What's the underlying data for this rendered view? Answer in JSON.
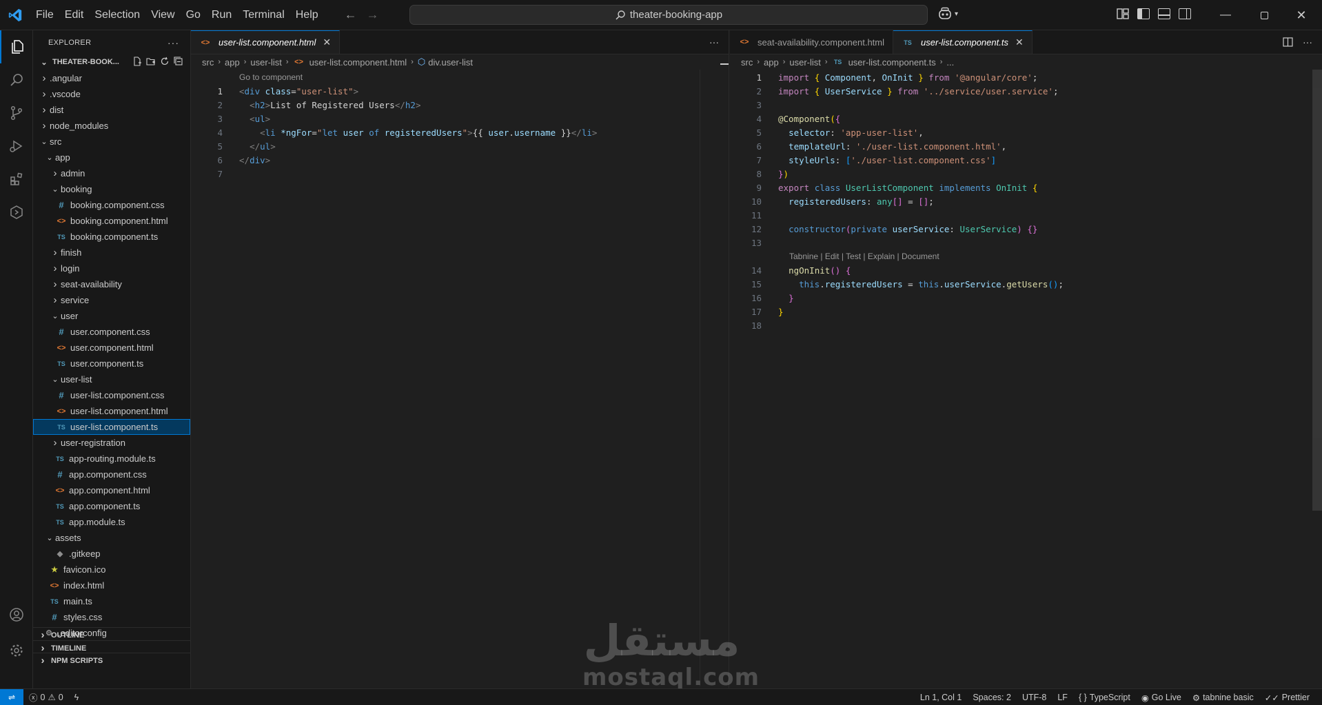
{
  "menu": [
    "File",
    "Edit",
    "Selection",
    "View",
    "Go",
    "Run",
    "Terminal",
    "Help"
  ],
  "command_center": "theater-booking-app",
  "sidebar": {
    "title": "EXPLORER",
    "project": "THEATER-BOOK...",
    "tree": [
      {
        "label": ".angular",
        "indent": 0,
        "type": "folder",
        "open": false
      },
      {
        "label": ".vscode",
        "indent": 0,
        "type": "folder",
        "open": false
      },
      {
        "label": "dist",
        "indent": 0,
        "type": "folder",
        "open": false
      },
      {
        "label": "node_modules",
        "indent": 0,
        "type": "folder",
        "open": false
      },
      {
        "label": "src",
        "indent": 0,
        "type": "folder",
        "open": true
      },
      {
        "label": "app",
        "indent": 1,
        "type": "folder",
        "open": true
      },
      {
        "label": "admin",
        "indent": 2,
        "type": "folder",
        "open": false
      },
      {
        "label": "booking",
        "indent": 2,
        "type": "folder",
        "open": true
      },
      {
        "label": "booking.component.css",
        "indent": 3,
        "type": "css"
      },
      {
        "label": "booking.component.html",
        "indent": 3,
        "type": "html"
      },
      {
        "label": "booking.component.ts",
        "indent": 3,
        "type": "ts"
      },
      {
        "label": "finish",
        "indent": 2,
        "type": "folder",
        "open": false
      },
      {
        "label": "login",
        "indent": 2,
        "type": "folder",
        "open": false
      },
      {
        "label": "seat-availability",
        "indent": 2,
        "type": "folder",
        "open": false
      },
      {
        "label": "service",
        "indent": 2,
        "type": "folder",
        "open": false
      },
      {
        "label": "user",
        "indent": 2,
        "type": "folder",
        "open": true
      },
      {
        "label": "user.component.css",
        "indent": 3,
        "type": "css"
      },
      {
        "label": "user.component.html",
        "indent": 3,
        "type": "html"
      },
      {
        "label": "user.component.ts",
        "indent": 3,
        "type": "ts"
      },
      {
        "label": "user-list",
        "indent": 2,
        "type": "folder",
        "open": true
      },
      {
        "label": "user-list.component.css",
        "indent": 3,
        "type": "css"
      },
      {
        "label": "user-list.component.html",
        "indent": 3,
        "type": "html"
      },
      {
        "label": "user-list.component.ts",
        "indent": 3,
        "type": "ts",
        "selected": true
      },
      {
        "label": "user-registration",
        "indent": 2,
        "type": "folder",
        "open": false
      },
      {
        "label": "app-routing.module.ts",
        "indent": 2,
        "type": "ts",
        "nochev": true
      },
      {
        "label": "app.component.css",
        "indent": 2,
        "type": "css",
        "nochev": true
      },
      {
        "label": "app.component.html",
        "indent": 2,
        "type": "html",
        "nochev": true
      },
      {
        "label": "app.component.ts",
        "indent": 2,
        "type": "ts",
        "nochev": true
      },
      {
        "label": "app.module.ts",
        "indent": 2,
        "type": "ts",
        "nochev": true
      },
      {
        "label": "assets",
        "indent": 1,
        "type": "folder",
        "open": true
      },
      {
        "label": ".gitkeep",
        "indent": 2,
        "type": "git",
        "nochev": true
      },
      {
        "label": "favicon.ico",
        "indent": 1,
        "type": "fav",
        "nochev": true
      },
      {
        "label": "index.html",
        "indent": 1,
        "type": "html",
        "nochev": true
      },
      {
        "label": "main.ts",
        "indent": 1,
        "type": "ts",
        "nochev": true
      },
      {
        "label": "styles.css",
        "indent": 1,
        "type": "css",
        "nochev": true
      },
      {
        "label": ".editorconfig",
        "indent": 0,
        "type": "cfg",
        "nochev": true
      }
    ],
    "sections": [
      "OUTLINE",
      "TIMELINE",
      "NPM SCRIPTS"
    ]
  },
  "left_editor": {
    "tab": "user-list.component.html",
    "breadcrumb": [
      "src",
      "app",
      "user-list",
      "user-list.component.html",
      "div.user-list"
    ],
    "codelens": "Go to component",
    "lines": [
      [
        [
          "tk-punc",
          "<"
        ],
        [
          "tk-tag",
          "div"
        ],
        [
          "tk-text",
          " "
        ],
        [
          "tk-attr",
          "class"
        ],
        [
          "tk-text",
          "="
        ],
        [
          "tk-str",
          "\"user-list\""
        ],
        [
          "tk-punc",
          ">"
        ]
      ],
      [
        [
          "tk-text",
          "  "
        ],
        [
          "tk-punc",
          "<"
        ],
        [
          "tk-tag",
          "h2"
        ],
        [
          "tk-punc",
          ">"
        ],
        [
          "tk-text",
          "List of Registered Users"
        ],
        [
          "tk-punc",
          "</"
        ],
        [
          "tk-tag",
          "h2"
        ],
        [
          "tk-punc",
          ">"
        ]
      ],
      [
        [
          "tk-text",
          "  "
        ],
        [
          "tk-punc",
          "<"
        ],
        [
          "tk-tag",
          "ul"
        ],
        [
          "tk-punc",
          ">"
        ]
      ],
      [
        [
          "tk-text",
          "    "
        ],
        [
          "tk-punc",
          "<"
        ],
        [
          "tk-tag",
          "li"
        ],
        [
          "tk-text",
          " "
        ],
        [
          "tk-attr",
          "*ngFor"
        ],
        [
          "tk-text",
          "="
        ],
        [
          "tk-str",
          "\""
        ],
        [
          "tk-kw2",
          "let "
        ],
        [
          "tk-var",
          "user"
        ],
        [
          "tk-kw2",
          " of "
        ],
        [
          "tk-var",
          "registeredUsers"
        ],
        [
          "tk-str",
          "\""
        ],
        [
          "tk-punc",
          ">"
        ],
        [
          "tk-text",
          "{{ "
        ],
        [
          "tk-var",
          "user"
        ],
        [
          "tk-text",
          "."
        ],
        [
          "tk-var",
          "username"
        ],
        [
          "tk-text",
          " }}"
        ],
        [
          "tk-punc",
          "</"
        ],
        [
          "tk-tag",
          "li"
        ],
        [
          "tk-punc",
          ">"
        ]
      ],
      [
        [
          "tk-text",
          "  "
        ],
        [
          "tk-punc",
          "</"
        ],
        [
          "tk-tag",
          "ul"
        ],
        [
          "tk-punc",
          ">"
        ]
      ],
      [
        [
          "tk-punc",
          "</"
        ],
        [
          "tk-tag",
          "div"
        ],
        [
          "tk-punc",
          ">"
        ]
      ],
      []
    ]
  },
  "right_editor": {
    "tabs": [
      "seat-availability.component.html",
      "user-list.component.ts"
    ],
    "breadcrumb": [
      "src",
      "app",
      "user-list",
      "user-list.component.ts",
      "..."
    ],
    "codelens": "Tabnine | Edit | Test | Explain | Document",
    "lines": [
      [
        [
          "tk-kw",
          "import"
        ],
        [
          "tk-text",
          " "
        ],
        [
          "tk-br1",
          "{"
        ],
        [
          "tk-text",
          " "
        ],
        [
          "tk-var",
          "Component"
        ],
        [
          "tk-text",
          ", "
        ],
        [
          "tk-var",
          "OnInit"
        ],
        [
          "tk-text",
          " "
        ],
        [
          "tk-br1",
          "}"
        ],
        [
          "tk-text",
          " "
        ],
        [
          "tk-kw",
          "from"
        ],
        [
          "tk-text",
          " "
        ],
        [
          "tk-str",
          "'@angular/core'"
        ],
        [
          "tk-text",
          ";"
        ]
      ],
      [
        [
          "tk-kw",
          "import"
        ],
        [
          "tk-text",
          " "
        ],
        [
          "tk-br1",
          "{"
        ],
        [
          "tk-text",
          " "
        ],
        [
          "tk-var",
          "UserService"
        ],
        [
          "tk-text",
          " "
        ],
        [
          "tk-br1",
          "}"
        ],
        [
          "tk-text",
          " "
        ],
        [
          "tk-kw",
          "from"
        ],
        [
          "tk-text",
          " "
        ],
        [
          "tk-str",
          "'../service/user.service'"
        ],
        [
          "tk-text",
          ";"
        ]
      ],
      [],
      [
        [
          "tk-fn",
          "@Component"
        ],
        [
          "tk-br1",
          "("
        ],
        [
          "tk-br2",
          "{"
        ]
      ],
      [
        [
          "tk-text",
          "  "
        ],
        [
          "tk-var",
          "selector"
        ],
        [
          "tk-text",
          ": "
        ],
        [
          "tk-str",
          "'app-user-list'"
        ],
        [
          "tk-text",
          ","
        ]
      ],
      [
        [
          "tk-text",
          "  "
        ],
        [
          "tk-var",
          "templateUrl"
        ],
        [
          "tk-text",
          ": "
        ],
        [
          "tk-str",
          "'./user-list.component.html'"
        ],
        [
          "tk-text",
          ","
        ]
      ],
      [
        [
          "tk-text",
          "  "
        ],
        [
          "tk-var",
          "styleUrls"
        ],
        [
          "tk-text",
          ": "
        ],
        [
          "tk-br3",
          "["
        ],
        [
          "tk-str",
          "'./user-list.component.css'"
        ],
        [
          "tk-br3",
          "]"
        ]
      ],
      [
        [
          "tk-br2",
          "}"
        ],
        [
          "tk-br1",
          ")"
        ]
      ],
      [
        [
          "tk-kw",
          "export"
        ],
        [
          "tk-text",
          " "
        ],
        [
          "tk-kw2",
          "class"
        ],
        [
          "tk-text",
          " "
        ],
        [
          "tk-cls",
          "UserListComponent"
        ],
        [
          "tk-text",
          " "
        ],
        [
          "tk-kw2",
          "implements"
        ],
        [
          "tk-text",
          " "
        ],
        [
          "tk-cls",
          "OnInit"
        ],
        [
          "tk-text",
          " "
        ],
        [
          "tk-br1",
          "{"
        ]
      ],
      [
        [
          "tk-text",
          "  "
        ],
        [
          "tk-var",
          "registeredUsers"
        ],
        [
          "tk-text",
          ": "
        ],
        [
          "tk-cls",
          "any"
        ],
        [
          "tk-br2",
          "[]"
        ],
        [
          "tk-text",
          " = "
        ],
        [
          "tk-br2",
          "[]"
        ],
        [
          "tk-text",
          ";"
        ]
      ],
      [],
      [
        [
          "tk-text",
          "  "
        ],
        [
          "tk-kw2",
          "constructor"
        ],
        [
          "tk-br2",
          "("
        ],
        [
          "tk-kw2",
          "private"
        ],
        [
          "tk-text",
          " "
        ],
        [
          "tk-var",
          "userService"
        ],
        [
          "tk-text",
          ": "
        ],
        [
          "tk-cls",
          "UserService"
        ],
        [
          "tk-br2",
          ")"
        ],
        [
          "tk-text",
          " "
        ],
        [
          "tk-br2",
          "{}"
        ]
      ],
      [],
      [
        [
          "tk-text",
          "  "
        ],
        [
          "tk-fn",
          "ngOnInit"
        ],
        [
          "tk-br2",
          "()"
        ],
        [
          "tk-text",
          " "
        ],
        [
          "tk-br2",
          "{"
        ]
      ],
      [
        [
          "tk-text",
          "    "
        ],
        [
          "tk-kw2",
          "this"
        ],
        [
          "tk-text",
          "."
        ],
        [
          "tk-var",
          "registeredUsers"
        ],
        [
          "tk-text",
          " = "
        ],
        [
          "tk-kw2",
          "this"
        ],
        [
          "tk-text",
          "."
        ],
        [
          "tk-var",
          "userService"
        ],
        [
          "tk-text",
          "."
        ],
        [
          "tk-fn",
          "getUsers"
        ],
        [
          "tk-br3",
          "()"
        ],
        [
          "tk-text",
          ";"
        ]
      ],
      [
        [
          "tk-text",
          "  "
        ],
        [
          "tk-br2",
          "}"
        ]
      ],
      [
        [
          "tk-br1",
          "}"
        ]
      ],
      []
    ]
  },
  "watermark": {
    "arabic": "مستقل",
    "latin": "mostaql.com"
  },
  "status": {
    "errors": "0",
    "warnings": "0",
    "position": "Ln 1, Col 1",
    "spaces": "Spaces: 2",
    "encoding": "UTF-8",
    "eol": "LF",
    "language": "TypeScript",
    "golive": "Go Live",
    "tabnine": "tabnine basic",
    "prettier": "Prettier"
  }
}
